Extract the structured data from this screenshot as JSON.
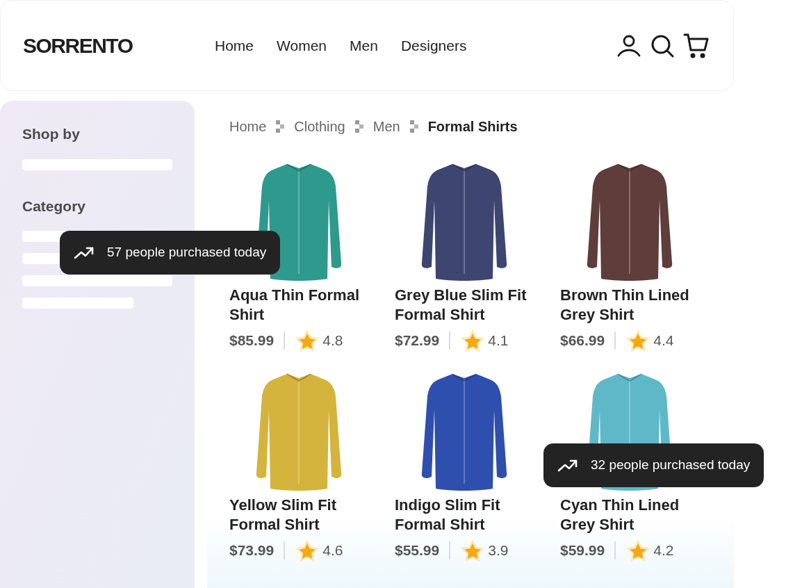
{
  "header": {
    "logo": "SORRENTO",
    "nav": [
      {
        "label": "Home"
      },
      {
        "label": "Women"
      },
      {
        "label": "Men"
      },
      {
        "label": "Designers"
      }
    ]
  },
  "sidebar": {
    "sections": [
      {
        "title": "Shop by"
      },
      {
        "title": "Category"
      }
    ]
  },
  "breadcrumb": [
    {
      "label": "Home",
      "current": false
    },
    {
      "label": "Clothing",
      "current": false
    },
    {
      "label": "Men",
      "current": false
    },
    {
      "label": "Formal Shirts",
      "current": true
    }
  ],
  "products": [
    {
      "name": "Aqua Thin Formal Shirt",
      "price": "$85.99",
      "rating": "4.8",
      "color": "#2e9a8e"
    },
    {
      "name": "Grey Blue Slim Fit Formal Shirt",
      "price": "$72.99",
      "rating": "4.1",
      "color": "#3d4670"
    },
    {
      "name": "Brown Thin Lined Grey Shirt",
      "price": "$66.99",
      "rating": "4.4",
      "color": "#5e3d3a"
    },
    {
      "name": "Yellow Slim Fit Formal Shirt",
      "price": "$73.99",
      "rating": "4.6",
      "color": "#d4b43c"
    },
    {
      "name": "Indigo Slim Fit Formal Shirt",
      "price": "$55.99",
      "rating": "3.9",
      "color": "#2f4fae"
    },
    {
      "name": "Cyan Thin Lined Grey Shirt",
      "price": "$59.99",
      "rating": "4.2",
      "color": "#5fb8c8"
    }
  ],
  "toasts": [
    {
      "text": "57 people purchased today"
    },
    {
      "text": "32 people purchased today"
    }
  ]
}
